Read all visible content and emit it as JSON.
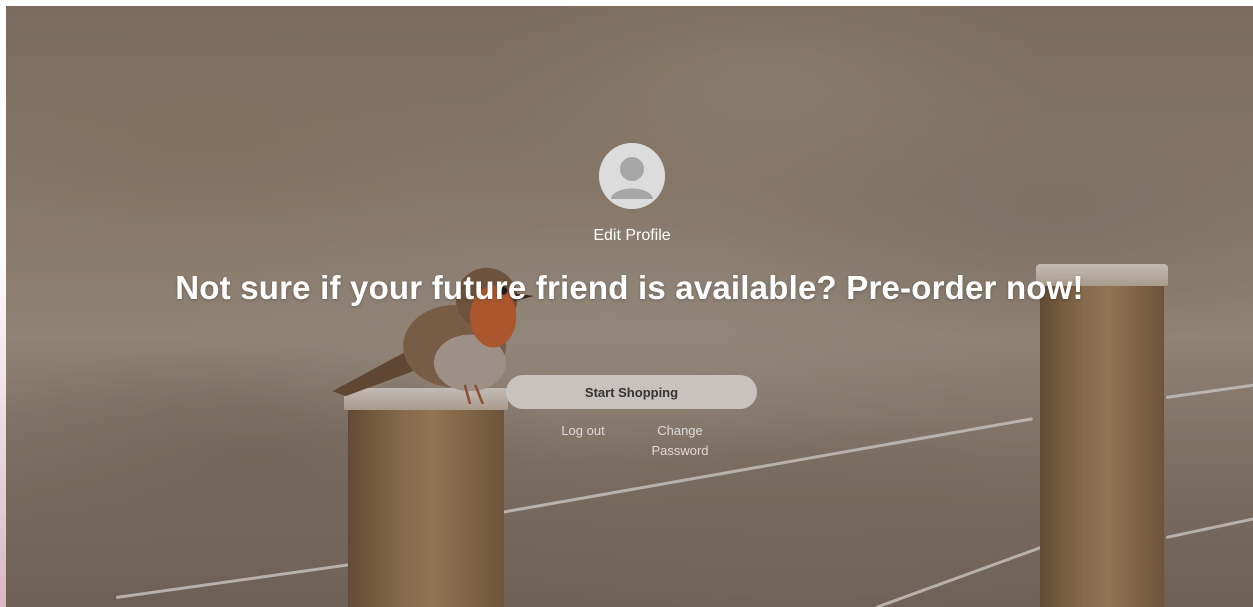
{
  "profile": {
    "avatar_icon": "user-avatar-icon",
    "edit_label": "Edit Profile"
  },
  "hero": {
    "headline": "Not sure if your future friend is available? Pre-order now!"
  },
  "actions": {
    "start_label": "Start Shopping",
    "logout_label": "Log out",
    "change_password_label": "Change Password"
  },
  "colors": {
    "text": "#ffffff",
    "button_bg": "#cdc8c6",
    "button_text": "#333333",
    "link_text": "#e6e1de"
  }
}
